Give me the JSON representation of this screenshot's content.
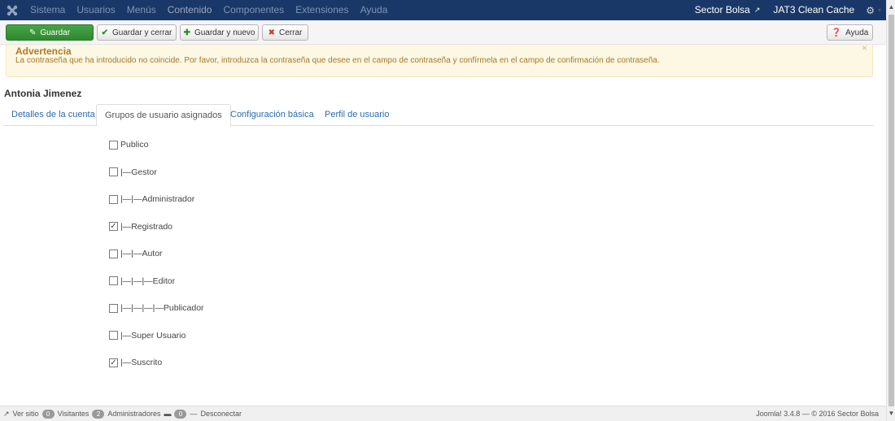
{
  "navbar": {
    "menu": [
      "Sistema",
      "Usuarios",
      "Menús",
      "Contenido",
      "Componentes",
      "Extensiones",
      "Ayuda"
    ],
    "active_index": 3,
    "site_link": "Sector Bolsa",
    "cache_link": "JAT3 Clean Cache",
    "logo_icon": "joomla-logo-icon",
    "gear_icon": "gear-icon"
  },
  "toolbar": {
    "save": "Guardar",
    "save_close": "Guardar y cerrar",
    "save_new": "Guardar y nuevo",
    "close": "Cerrar",
    "help": "Ayuda"
  },
  "alert": {
    "title": "Advertencia",
    "message": "La contraseña que ha introducido no coincide. Por favor, introduzca la contraseña que desee en el campo de contraseña y confírmela en el campo de confirmación de contraseña.",
    "close": "×"
  },
  "user": {
    "name": "Antonia Jimenez"
  },
  "tabs": [
    "Detalles de la cuenta",
    "Grupos de usuario asignados",
    "Configuración básica",
    "Perfil de usuario"
  ],
  "active_tab": 1,
  "groups": [
    {
      "label": "Publico",
      "checked": false
    },
    {
      "label": "|—Gestor",
      "checked": false
    },
    {
      "label": "|—|—Administrador",
      "checked": false
    },
    {
      "label": "|—Registrado",
      "checked": true
    },
    {
      "label": "|—|—Autor",
      "checked": false
    },
    {
      "label": "|—|—|—Editor",
      "checked": false
    },
    {
      "label": "|—|—|—|—Publicador",
      "checked": false
    },
    {
      "label": "|—Super Usuario",
      "checked": false
    },
    {
      "label": "|—Suscrito",
      "checked": true
    }
  ],
  "statusbar": {
    "view_site": "Ver sitio",
    "visitors_count": "0",
    "visitors": "Visitantes",
    "admins_count": "2",
    "admins": "Administradores",
    "messages_count": "0",
    "logout": "Desconectar",
    "version": "Joomla! 3.4.8 — © 2016 Sector Bolsa"
  },
  "colors": {
    "navbar": "#1a3867",
    "primary_button": "#3d9a3d",
    "alert_bg": "#fcf8e3",
    "link": "#2a6cae"
  }
}
